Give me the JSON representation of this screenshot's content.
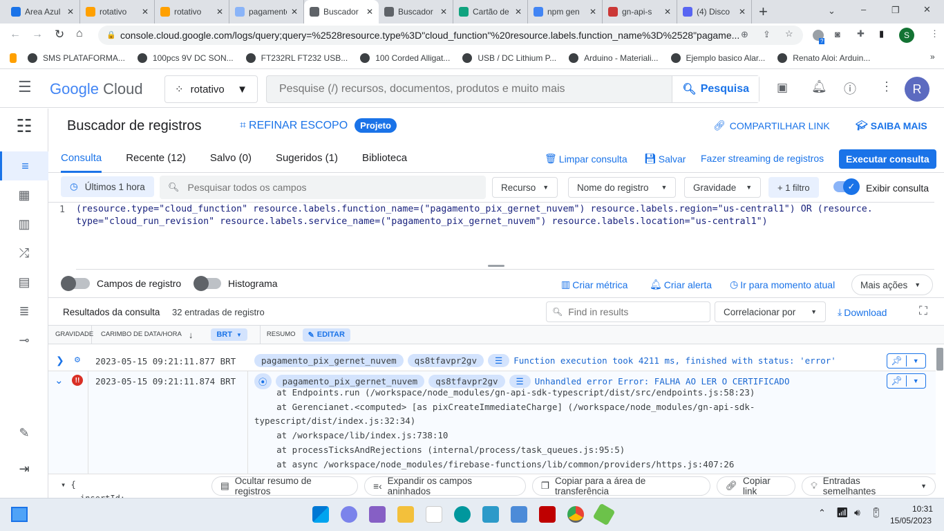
{
  "browser": {
    "tabs": [
      {
        "title": "Area Azul",
        "color": "#1a73e8"
      },
      {
        "title": "rotativo",
        "color": "#ffa000"
      },
      {
        "title": "rotativo",
        "color": "#ffa000"
      },
      {
        "title": "pagamento",
        "color": "#8ab4f8"
      },
      {
        "title": "Buscador",
        "color": "#5f6368",
        "active": true
      },
      {
        "title": "Buscador",
        "color": "#5f6368"
      },
      {
        "title": "Cartão de",
        "color": "#10a37f"
      },
      {
        "title": "npm gen",
        "color": "#4285f4"
      },
      {
        "title": "gn-api-s",
        "color": "#cb3837"
      },
      {
        "title": "(4) Disco",
        "color": "#5865f2"
      }
    ],
    "new_tab": "+",
    "url": "console.cloud.google.com/logs/query;query=%2528resource.type%3D\"cloud_function\"%20resource.labels.function_name%3D%2528\"pagame...",
    "profile_initial": "S",
    "extension_badge": "?",
    "bookmarks": [
      "SMS PLATAFORMA...",
      "100pcs 9V DC SON...",
      "FT232RL FT232 USB...",
      "100 Corded Alligat...",
      "USB / DC Lithium P...",
      "Arduino - Materiali...",
      "Ejemplo basico Alar...",
      "Renato Aloi: Arduin..."
    ],
    "bookmarks_more": "»"
  },
  "header": {
    "logo_google": "Google",
    "logo_cloud": "Cloud",
    "project": "rotativo",
    "search_placeholder": "Pesquise (/) recursos, documentos, produtos e muito mais",
    "search_button": "Pesquisa",
    "avatar": "R"
  },
  "page": {
    "title": "Buscador de registros",
    "refine": "REFINAR ESCOPO",
    "scope_badge": "Projeto",
    "share": "COMPARTILHAR LINK",
    "learn": "SAIBA MAIS"
  },
  "tabs": [
    {
      "label": "Consulta",
      "active": true
    },
    {
      "label": "Recente (12)"
    },
    {
      "label": "Salvo (0)"
    },
    {
      "label": "Sugeridos (1)"
    },
    {
      "label": "Biblioteca"
    }
  ],
  "actions": {
    "clear": "Limpar consulta",
    "save": "Salvar",
    "stream": "Fazer streaming de registros",
    "run": "Executar consulta"
  },
  "filters": {
    "time": "Últimos 1 hora",
    "search_placeholder": "Pesquisar todos os campos",
    "resource": "Recurso",
    "log_name": "Nome do registro",
    "severity": "Gravidade",
    "more": "+ 1 filtro",
    "show_query": "Exibir consulta",
    "show_query_on": true
  },
  "query": {
    "line_number": "1",
    "line1": "(resource.type=\"cloud_function\" resource.labels.function_name=(\"pagamento_pix_gernet_nuvem\") resource.labels.region=\"us-central1\") OR (resource.",
    "line2": "type=\"cloud_run_revision\" resource.labels.service_name=(\"pagamento_pix_gernet_nuvem\") resource.labels.location=\"us-central1\")"
  },
  "toolbar": {
    "log_fields": "Campos de registro",
    "log_fields_on": false,
    "histogram": "Histograma",
    "histogram_on": false,
    "create_metric": "Criar métrica",
    "create_alert": "Criar alerta",
    "jump_now": "Ir para momento atual",
    "more_actions": "Mais ações"
  },
  "results": {
    "title": "Resultados da consulta",
    "count": "32 entradas de registro",
    "find_placeholder": "Find in results",
    "correlate": "Correlacionar por",
    "download": "Download"
  },
  "table": {
    "headers": {
      "severity": "GRAVIDADE",
      "timestamp": "CARIMBO DE DATA/HORA",
      "tz": "BRT",
      "summary": "RESUMO",
      "edit": "EDITAR"
    },
    "rows": [
      {
        "severity": "debug",
        "timestamp": "2023-05-15 09:21:11.877 BRT",
        "function": "pagamento_pix_gernet_nuvem",
        "instance": "qs8tfavpr2gv",
        "message": "Function execution took 4211 ms, finished with status: 'error'"
      },
      {
        "severity": "error",
        "timestamp": "2023-05-15 09:21:11.874 BRT",
        "function": "pagamento_pix_gernet_nuvem",
        "instance": "qs8tfavpr2gv",
        "message": "Unhandled error Error: FALHA AO LER O CERTIFICADO",
        "stack": [
          "    at Endpoints.run (/workspace/node_modules/gn-api-sdk-typescript/dist/src/endpoints.js:58:23)",
          "    at Gerencianet.<computed> [as pixCreateImmediateCharge] (/workspace/node_modules/gn-api-sdk-",
          "typescript/dist/index.js:32:34)",
          "    at /workspace/lib/index.js:738:10",
          "    at processTicksAndRejections (internal/process/task_queues.js:95:5)",
          "    at async /workspace/node_modules/firebase-functions/lib/common/providers/https.js:407:26"
        ]
      }
    ],
    "json_open": "{",
    "json_key": "insertId:"
  },
  "bottom_actions": [
    "Ocultar resumo de registros",
    "Expandir os campos aninhados",
    "Copiar para a área de transferência",
    "Copiar link",
    "Entradas semelhantes"
  ],
  "taskbar": {
    "time": "10:31",
    "date": "15/05/2023"
  }
}
